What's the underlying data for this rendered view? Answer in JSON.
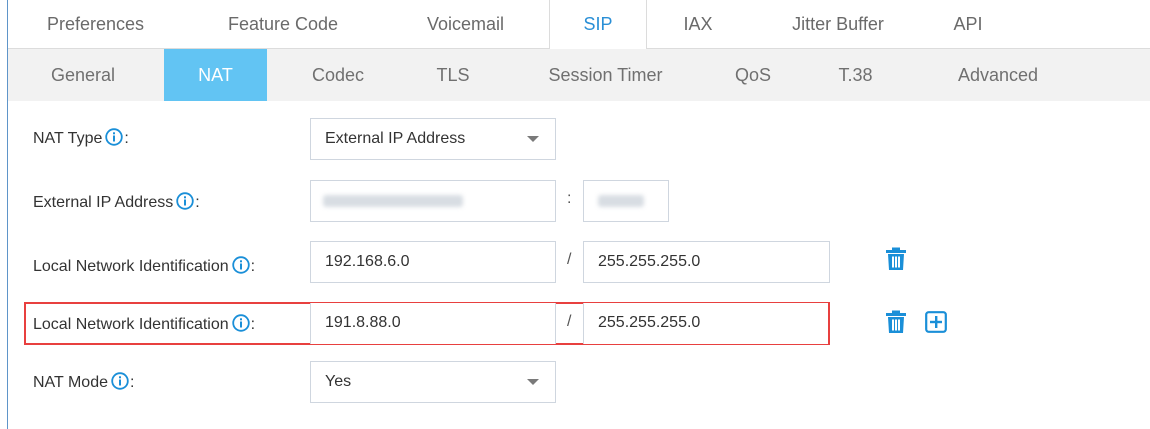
{
  "top_tabs": [
    "Preferences",
    "Feature Code",
    "Voicemail",
    "SIP",
    "IAX",
    "Jitter Buffer",
    "API"
  ],
  "sub_tabs": [
    "General",
    "NAT",
    "Codec",
    "TLS",
    "Session Timer",
    "QoS",
    "T.38",
    "Advanced"
  ],
  "active_top_tab": "SIP",
  "active_sub_tab": "NAT",
  "form": {
    "nat_type": {
      "label": "NAT Type",
      "suffix": ":",
      "value": "External IP Address"
    },
    "external_ip": {
      "label": "External IP Address",
      "suffix": ":",
      "separator": ":"
    },
    "local_network_1": {
      "label": "Local Network Identification",
      "suffix": ":",
      "ip": "192.168.6.0",
      "separator": "/",
      "mask": "255.255.255.0"
    },
    "local_network_2": {
      "label": "Local Network Identification",
      "suffix": ":",
      "ip": "191.8.88.0",
      "separator": "/",
      "mask": "255.255.255.0"
    },
    "nat_mode": {
      "label": "NAT Mode",
      "suffix": ":",
      "value": "Yes"
    }
  },
  "colors": {
    "accent": "#2a8fd6",
    "active_sub_tab_bg": "#62c4f3",
    "highlight_border": "#e8403f",
    "icon_blue": "#1a8fd8"
  },
  "icons": [
    "info-icon",
    "trash-icon",
    "plus-box-icon",
    "chevron-down-icon"
  ]
}
